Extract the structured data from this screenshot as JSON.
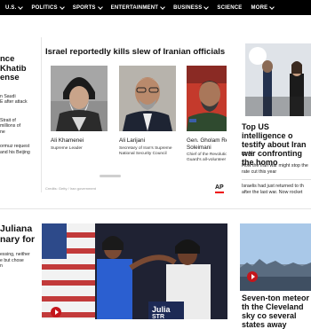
{
  "nav": {
    "items": [
      {
        "label": "U.S.",
        "has_chevron": true
      },
      {
        "label": "POLITICS",
        "has_chevron": true
      },
      {
        "label": "SPORTS",
        "has_chevron": true
      },
      {
        "label": "ENTERTAINMENT",
        "has_chevron": true
      },
      {
        "label": "BUSINESS",
        "has_chevron": true
      },
      {
        "label": "SCIENCE",
        "has_chevron": false
      },
      {
        "label": "MORE",
        "has_chevron": true
      }
    ]
  },
  "left_story": {
    "headline": [
      "nce",
      "Khatib",
      "ense"
    ],
    "para1": [
      "n Saudi",
      "E after attack"
    ],
    "para2": [
      "Strait of",
      "millions of",
      "ne"
    ],
    "para3": [
      "ormuz request",
      "and his Beijing"
    ]
  },
  "carousel": {
    "title": "Israel reportedly kills slew of Iranian officials",
    "cards": [
      {
        "name": "Ali Khamenei",
        "role": [
          "Supreme Leader"
        ]
      },
      {
        "name": "Ali Larijani",
        "role": [
          "Secretary of Iran's Supreme",
          "National Security Council"
        ]
      },
      {
        "name": "Gen. Gholam Re",
        "name2": "Soleimani",
        "role": [
          "Chief of the Revolutio",
          "Guard's all-volunteer"
        ]
      }
    ],
    "credit": "Credits: Getty / Iran government",
    "source_logo": "AP"
  },
  "right_story": {
    "headline": "Top US intelligence o testify about Iran war confronting the homo",
    "comments": "44",
    "related1": "How the Iran war might stop the rate cut this year",
    "related2": "Israelis had just returned to th after the last war. Now rocket"
  },
  "bottom_left": {
    "headline": [
      "Juliana",
      "nary for"
    ],
    "para": [
      "essing, neither",
      "e but chose",
      "n"
    ]
  },
  "bottom_right": {
    "headline": "Seven-ton meteor th the Cleveland sky co several states away"
  },
  "colors": {
    "accent_red": "#c4161c",
    "nav_bg": "#000000"
  }
}
